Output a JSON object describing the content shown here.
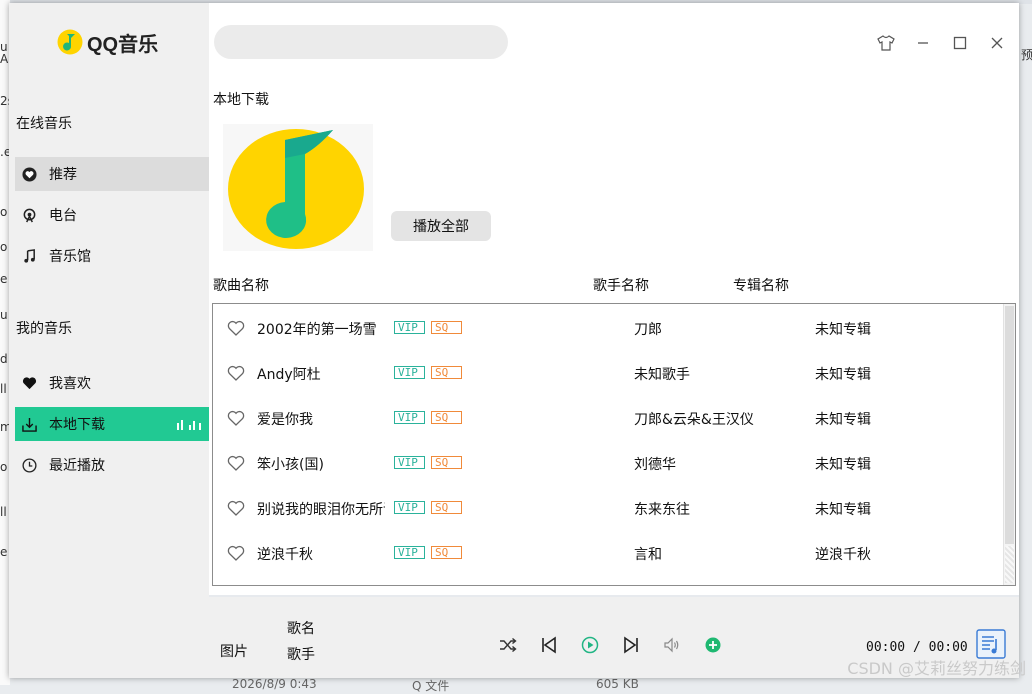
{
  "app": {
    "logo_text": "QQ音乐"
  },
  "sidebar": {
    "online_title": "在线音乐",
    "online_items": [
      {
        "label": "推荐",
        "icon": "heart-circle-icon"
      },
      {
        "label": "电台",
        "icon": "radio-icon"
      },
      {
        "label": "音乐馆",
        "icon": "music-note-icon"
      }
    ],
    "my_title": "我的音乐",
    "my_items": [
      {
        "label": "我喜欢",
        "icon": "heart-icon"
      },
      {
        "label": "本地下载",
        "icon": "download-icon"
      },
      {
        "label": "最近播放",
        "icon": "clock-icon"
      }
    ]
  },
  "search": {
    "placeholder": ""
  },
  "page": {
    "title": "本地下载",
    "play_all": "播放全部",
    "columns": {
      "song": "歌曲名称",
      "artist": "歌手名称",
      "album": "专辑名称"
    }
  },
  "badges": {
    "vip": "VIP",
    "sq": "SQ"
  },
  "songs": [
    {
      "title": "2002年的第一场雪",
      "artist": "刀郎",
      "album": "未知专辑"
    },
    {
      "title": "Andy阿杜",
      "artist": "未知歌手",
      "album": "未知专辑"
    },
    {
      "title": "爱是你我",
      "artist": "刀郎&云朵&王汉仪",
      "album": "未知专辑"
    },
    {
      "title": "笨小孩(国)",
      "artist": "刘德华",
      "album": "未知专辑"
    },
    {
      "title": "别说我的眼泪你无所谓",
      "artist": "东来东往",
      "album": "未知专辑"
    },
    {
      "title": "逆浪千秋",
      "artist": "言和",
      "album": "逆浪千秋"
    }
  ],
  "player": {
    "picture_label": "图片",
    "song_name": "歌名",
    "artist_name": "歌手",
    "time": "00:00 / 00:00"
  },
  "colors": {
    "accent": "#21c993",
    "vip": "#2ab29b",
    "sq": "#f08a3a"
  },
  "watermark": "CSDN @艾莉丝努力练剑",
  "background": {
    "left_letters": [
      "u",
      "A",
      "2s",
      ".e",
      "o",
      "o",
      "e",
      "u",
      "d",
      "ll",
      "m",
      "o",
      "ll",
      "e"
    ],
    "top_right_fragment": "预",
    "bottom_fragments": [
      "2026/8/9 0:43",
      "Q 文件",
      "605 KB"
    ]
  }
}
